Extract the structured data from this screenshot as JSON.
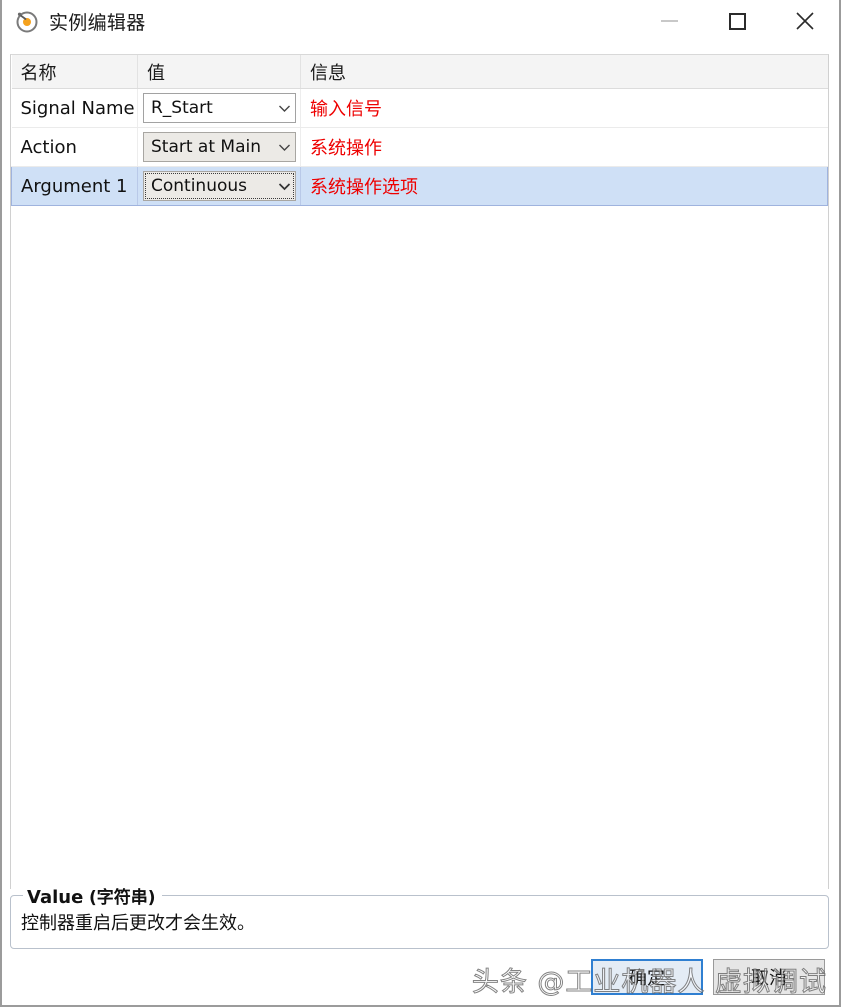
{
  "window": {
    "title": "实例编辑器",
    "icon": "instance-editor-icon",
    "controls": {
      "minimize_label": "—",
      "maximize_label": "□",
      "close_label": "✕"
    }
  },
  "grid": {
    "columns": [
      "名称",
      "值",
      "信息"
    ],
    "rows": [
      {
        "name": "Signal Name",
        "value": "R_Start",
        "value_style": "white",
        "info": "输入信号",
        "selected": false
      },
      {
        "name": "Action",
        "value": "Start at Main",
        "value_style": "gray",
        "info": "系统操作",
        "selected": false
      },
      {
        "name": "Argument 1",
        "value": "Continuous",
        "value_style": "focus",
        "info": "系统操作选项",
        "selected": true
      }
    ]
  },
  "detail_panel": {
    "title_main": "Value",
    "title_suffix": "(字符串)",
    "description": "控制器重启后更改才会生效。"
  },
  "footer": {
    "ok_label": "确定",
    "cancel_label": "取消"
  },
  "watermark": {
    "text": "头条 @工业机器人 虚拟调试"
  },
  "colors": {
    "info_text": "#ee0000",
    "selection_bg": "#cfe0f6",
    "selection_border": "#9fb3de",
    "header_bg": "#f4f4f4",
    "default_button_border": "#2f7fd1"
  }
}
